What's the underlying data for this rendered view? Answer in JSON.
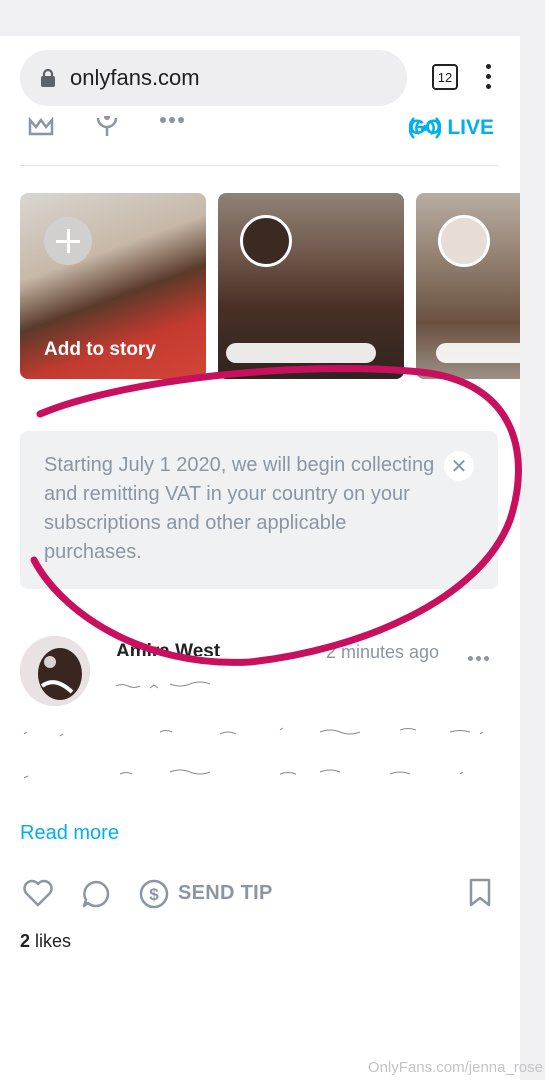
{
  "browser": {
    "url": "onlyfans.com",
    "tab_count": "12"
  },
  "top_nav": {
    "golive_label": "GO LIVE"
  },
  "stories": [
    {
      "label": "Add to story"
    },
    {
      "label": ""
    },
    {
      "label": ""
    }
  ],
  "notice": {
    "text": "Starting July 1 2020, we will begin collecting and remitting VAT in your country on your subscriptions and other applicable purchases."
  },
  "post": {
    "author": "Amira West",
    "time": "2 minutes ago",
    "read_more": "Read more",
    "send_tip": "SEND TIP",
    "likes_count": "2",
    "likes_label": " likes"
  },
  "watermark": "OnlyFans.com/jenna_rose",
  "colors": {
    "accent": "#00aff0",
    "muted": "#8a96a3",
    "annotation": "#c8105e"
  }
}
